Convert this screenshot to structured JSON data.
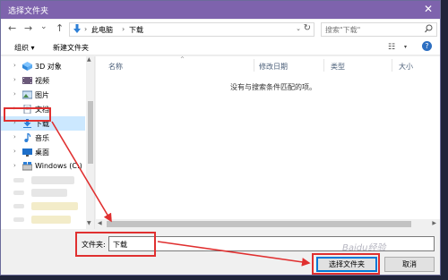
{
  "window": {
    "title": "选择文件夹",
    "close_glyph": "✕"
  },
  "address_bar": {
    "back": "←",
    "forward": "→",
    "history": "⌄",
    "up": "↑",
    "crumbs": [
      "此电脑",
      "下载"
    ],
    "separator": "›",
    "dropdown": "⌄",
    "refresh": "↻"
  },
  "search": {
    "placeholder": "搜索\"下载\""
  },
  "toolbar": {
    "organize_label": "组织 ▾",
    "new_folder_label": "新建文件夹",
    "view_glyph": "☷",
    "view_drop": "▾",
    "help_glyph": "?"
  },
  "nav_pane": {
    "arrow": "›",
    "items": [
      {
        "label": "3D 对象",
        "icon": "3d-objects-icon"
      },
      {
        "label": "视频",
        "icon": "video-icon"
      },
      {
        "label": "图片",
        "icon": "pictures-icon"
      },
      {
        "label": "文档",
        "icon": "documents-icon"
      },
      {
        "label": "下载",
        "icon": "download-icon",
        "selected": true
      },
      {
        "label": "音乐",
        "icon": "music-icon"
      },
      {
        "label": "桌面",
        "icon": "desktop-icon"
      },
      {
        "label": "Windows (C:)",
        "icon": "drive-icon"
      }
    ],
    "scroll_up": "▲",
    "scroll_down": "▼"
  },
  "file_list": {
    "columns": [
      "名称",
      "修改日期",
      "类型",
      "大小"
    ],
    "sort_caret": "^",
    "empty_message": "没有与搜索条件匹配的项。",
    "scroll_left": "◀",
    "scroll_right": "▶"
  },
  "footer": {
    "folder_label": "文件夹:",
    "folder_value": "下载",
    "select_button": "选择文件夹",
    "cancel_button": "取消"
  },
  "watermark": "Baidu经验",
  "colors": {
    "titlebar": "#7e63ad",
    "selection": "#cce8ff",
    "annotation": "#e03030",
    "primary_border": "#0078d7"
  }
}
